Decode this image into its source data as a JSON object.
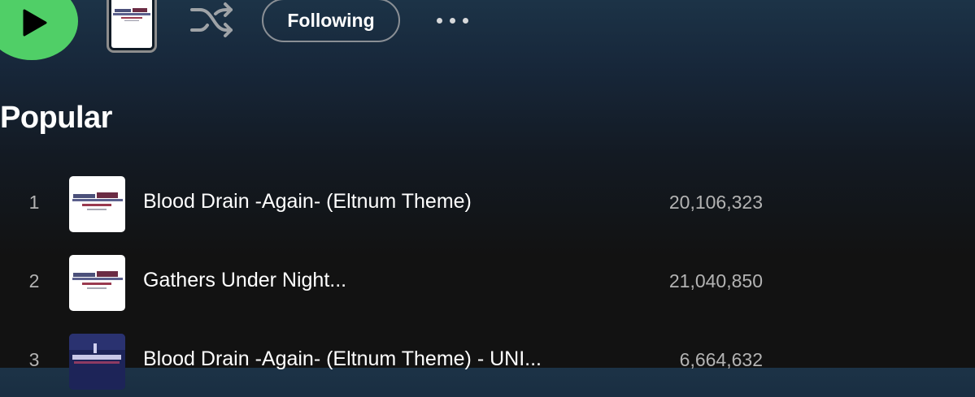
{
  "action_bar": {
    "play_icon": "play-icon",
    "shuffle_icon": "shuffle-icon",
    "following_label": "Following",
    "more_icon": "more-horizontal-icon"
  },
  "popular": {
    "title": "Popular",
    "tracks": [
      {
        "index": "1",
        "title": "Blood Drain -Again- (Eltnum Theme)",
        "plays": "20,106,323"
      },
      {
        "index": "2",
        "title": "Gathers Under Night...",
        "plays": "21,040,850"
      },
      {
        "index": "3",
        "title": "Blood Drain -Again- (Eltnum Theme) - UNI...",
        "plays": "6,664,632"
      }
    ]
  },
  "colors": {
    "accent": "#50cf67",
    "background": "#121212",
    "header_tint": "#1c3347",
    "secondary_text": "#b3b3b3"
  }
}
